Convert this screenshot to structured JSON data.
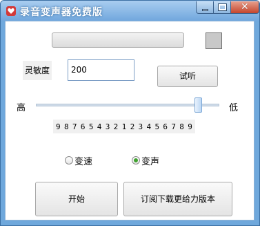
{
  "window": {
    "title": "录音变声器免费版",
    "accent": "#6fa8dc",
    "close_color": "#c4452d"
  },
  "progress": {
    "value": 0
  },
  "sensitivity": {
    "label": "灵敏度",
    "value": "200"
  },
  "listen_button": "试听",
  "pitch": {
    "high_label": "高",
    "low_label": "低",
    "value": 0.9,
    "scale": [
      "9",
      "8",
      "7",
      "6",
      "5",
      "4",
      "3",
      "2",
      "1",
      "2",
      "3",
      "4",
      "5",
      "6",
      "7",
      "8",
      "9"
    ]
  },
  "options": [
    {
      "label": "变速",
      "checked": false
    },
    {
      "label": "变声",
      "checked": true
    }
  ],
  "buttons": {
    "start": "开始",
    "upgrade": "订阅下载更给力版本"
  },
  "icons": {
    "app": "heart-icon",
    "minimize": "minimize-icon",
    "maximize": "maximize-icon",
    "close": "close-icon"
  }
}
